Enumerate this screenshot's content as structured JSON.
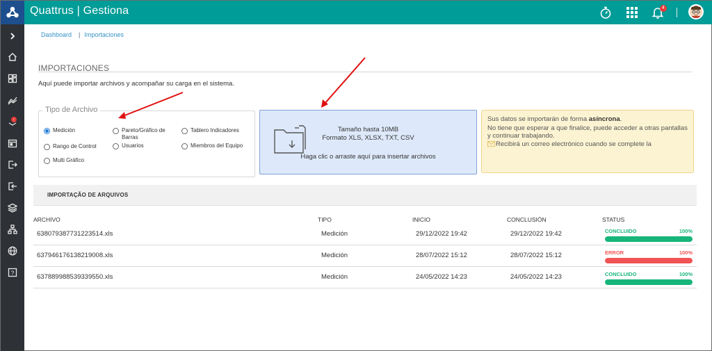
{
  "app": {
    "brand": "Quattrus | Gestiona",
    "notification_count": "4",
    "colors": {
      "topbar": "#009c97",
      "sidebar": "#2e3136",
      "logo_bg": "#1d4f8f",
      "accent": "#1e7bd6",
      "success": "#17b57a",
      "error": "#f05454"
    }
  },
  "topbar_icons": [
    "stopwatch-icon",
    "apps-grid-icon",
    "bell-icon",
    "user-avatar"
  ],
  "sidebar_icons": [
    "chevron-right-icon",
    "home-icon",
    "dashboard-icon",
    "chart-icon",
    "alert-icon",
    "calendar-icon",
    "export-icon",
    "import-icon",
    "layers-icon",
    "hierarchy-icon",
    "globe-icon",
    "help-icon"
  ],
  "breadcrumb": {
    "root": "Dashboard",
    "current": "Importaciones"
  },
  "section": {
    "title": "IMPORTACIONES",
    "description": "Aquí puede importar archivos y acompañar su carga en el sistema."
  },
  "tipo_archivo": {
    "legend": "Tipo de Archivo",
    "options": [
      {
        "label": "Medición",
        "selected": true
      },
      {
        "label": "Pareto/Gráfico de Barras",
        "selected": false
      },
      {
        "label": "Tablero Indicadores",
        "selected": false
      },
      {
        "label": "Rango de Control",
        "selected": false
      },
      {
        "label": "Usuarios",
        "selected": false
      },
      {
        "label": "Miembros del Equipo",
        "selected": false
      },
      {
        "label": "Multi Gráfico",
        "selected": false
      }
    ]
  },
  "dropzone": {
    "size_text": "Tamaño hasta 10MB",
    "format_text": "Formato XLS, XLSX, TXT, CSV",
    "cta": "Haga clic o arraste aquí para insertar archivos"
  },
  "info": {
    "line1_prefix": "Sus datos se importarán de forma ",
    "line1_bold": "asíncrona",
    "line1_suffix": ".",
    "line2": "No tiene que esperar a que finalice, puede acceder a otras pantallas",
    "line3": "y continuar trabajando.",
    "line4": "Recibirá un correo electrónico cuando se complete la"
  },
  "imports": {
    "title": "IMPORTAÇÃO DE ARQUIVOS",
    "columns": [
      "ARCHIVO",
      "TIPO",
      "INICIO",
      "CONCLUSIÓN",
      "STATUS"
    ],
    "rows": [
      {
        "archivo": "638079387731223514.xls",
        "tipo": "Medición",
        "inicio": "29/12/2022 19:42",
        "conclusion": "29/12/2022 19:42",
        "status": "CONCLUIDO",
        "progress": "100%",
        "progress_value": 1.0,
        "status_color": "#17b57a"
      },
      {
        "archivo": "637946176138219008.xls",
        "tipo": "Medición",
        "inicio": "28/07/2022 15:12",
        "conclusion": "28/07/2022 15:12",
        "status": "ERROR",
        "progress": "100%",
        "progress_value": 1.0,
        "status_color": "#f05454"
      },
      {
        "archivo": "637889988539339550.xls",
        "tipo": "Medición",
        "inicio": "24/05/2022 14:23",
        "conclusion": "24/05/2022 14:23",
        "status": "CONCLUIDO",
        "progress": "100%",
        "progress_value": 1.0,
        "status_color": "#17b57a"
      }
    ]
  }
}
